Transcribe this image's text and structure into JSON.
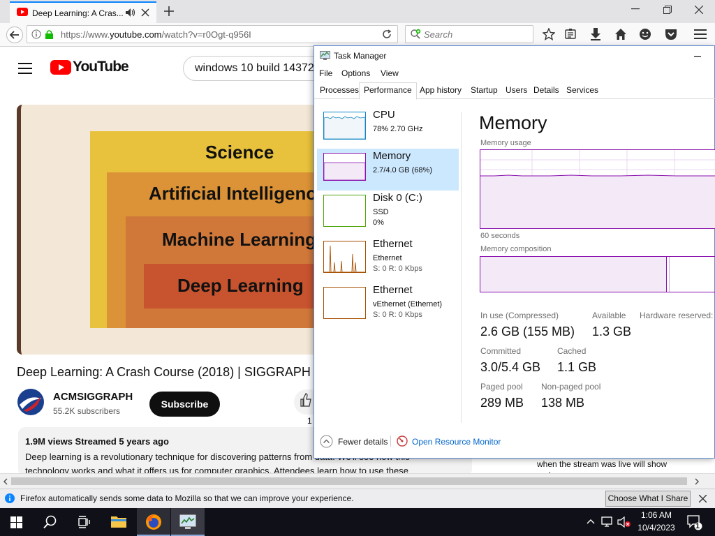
{
  "browser": {
    "tab_title": "Deep Learning: A Cras...",
    "url_prefix": "https://www.",
    "url_domain": "youtube.com",
    "url_path": "/watch?v=r0Ogt-q956I",
    "search_placeholder": "Search",
    "notification_text": "Firefox automatically sends some data to Mozilla so that we can improve your experience.",
    "notification_button": "Choose What I Share"
  },
  "youtube": {
    "logo_text": "YouTube",
    "search_value": "windows 10 build 14372",
    "video_levels": [
      "Science",
      "Artificial Intelligence",
      "Machine Learning",
      "Deep Learning"
    ],
    "video_title": "Deep Learning: A Crash Course (2018) | SIGGRAPH",
    "channel_name": "ACMSIGGRAPH",
    "channel_subs": "55.2K subscribers",
    "subscribe_label": "Subscribe",
    "like_count": "1",
    "desc_meta": "1.9M views  Streamed 5 years ago",
    "desc_body": "Deep learning is a revolutionary technique for discovering patterns from data. We'll see how this technology works and what it offers us for computer graphics. Attendees learn how to use these",
    "chat_text": "when the stream was live will show up here."
  },
  "task_manager": {
    "title": "Task Manager",
    "menu": [
      "File",
      "Options",
      "View"
    ],
    "tabs": [
      "Processes",
      "Performance",
      "App history",
      "Startup",
      "Users",
      "Details",
      "Services"
    ],
    "resources": [
      {
        "name": "CPU",
        "line1": "78%  2.70 GHz",
        "line2": ""
      },
      {
        "name": "Memory",
        "line1": "2.7/4.0 GB (68%)",
        "line2": ""
      },
      {
        "name": "Disk 0 (C:)",
        "line1": "SSD",
        "line2": "0%"
      },
      {
        "name": "Ethernet",
        "line1": "Ethernet",
        "line2": "S: 0  R: 0 Kbps"
      },
      {
        "name": "Ethernet",
        "line1": "vEthernet (Ethernet)",
        "line2": "S: 0  R: 0 Kbps"
      }
    ],
    "memory": {
      "title": "Memory",
      "usage_label": "Memory usage",
      "seconds_label": "60 seconds",
      "composition_label": "Memory composition",
      "in_use_label": "In use (Compressed)",
      "in_use_value": "2.6 GB (155 MB)",
      "available_label": "Available",
      "available_value": "1.3 GB",
      "hw_reserved_label": "Hardware reserved:",
      "committed_label": "Committed",
      "committed_value": "3.0/5.4 GB",
      "cached_label": "Cached",
      "cached_value": "1.1 GB",
      "paged_label": "Paged pool",
      "paged_value": "289 MB",
      "nonpaged_label": "Non-paged pool",
      "nonpaged_value": "138 MB"
    },
    "fewer_details": "Fewer details",
    "open_resource_monitor": "Open Resource Monitor"
  },
  "taskbar": {
    "time": "1:06 AM",
    "date": "10/4/2023",
    "notification_count": "1"
  },
  "colors": {
    "youtube_red": "#ff0000",
    "memory_purple": "#8b12ae",
    "cpu_blue": "#1185c4",
    "disk_green": "#4da60c",
    "ethernet_orange": "#a74f01",
    "selected_bg": "#cce8ff",
    "link_blue": "#0066cc"
  }
}
